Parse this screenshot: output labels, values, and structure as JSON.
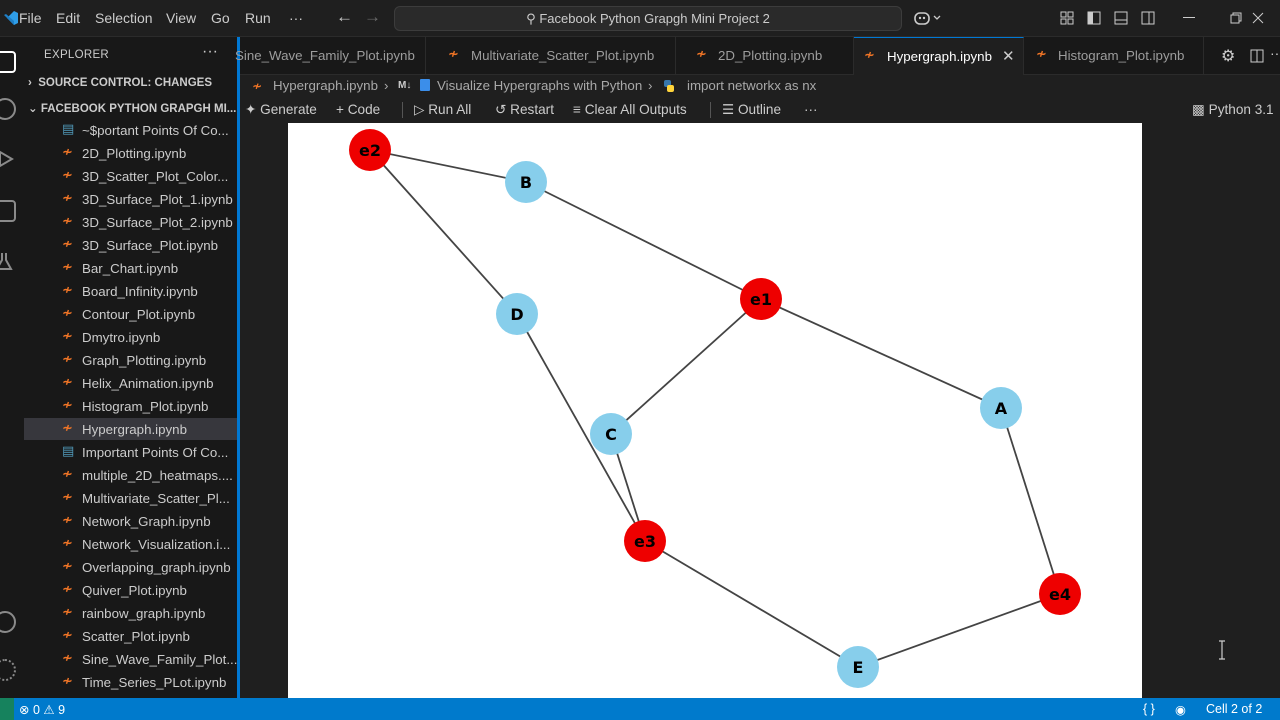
{
  "menu": [
    "File",
    "Edit",
    "Selection",
    "View",
    "Go",
    "Run",
    "···"
  ],
  "search": {
    "label": "Facebook Python Grapgh Mini Project 2"
  },
  "explorer": {
    "title": "EXPLORER",
    "more": "···",
    "source_control": "SOURCE CONTROL: CHANGES",
    "project": "FACEBOOK PYTHON GRAPGH MI...",
    "files": [
      {
        "name": "~$portant Points Of Co...",
        "kind": "md"
      },
      {
        "name": "2D_Plotting.ipynb",
        "kind": "nb"
      },
      {
        "name": "3D_Scatter_Plot_Color...",
        "kind": "nb"
      },
      {
        "name": "3D_Surface_Plot_1.ipynb",
        "kind": "nb"
      },
      {
        "name": "3D_Surface_Plot_2.ipynb",
        "kind": "nb"
      },
      {
        "name": "3D_Surface_Plot.ipynb",
        "kind": "nb"
      },
      {
        "name": "Bar_Chart.ipynb",
        "kind": "nb"
      },
      {
        "name": "Board_Infinity.ipynb",
        "kind": "nb"
      },
      {
        "name": "Contour_Plot.ipynb",
        "kind": "nb"
      },
      {
        "name": "Dmytro.ipynb",
        "kind": "nb"
      },
      {
        "name": "Graph_Plotting.ipynb",
        "kind": "nb"
      },
      {
        "name": "Helix_Animation.ipynb",
        "kind": "nb"
      },
      {
        "name": "Histogram_Plot.ipynb",
        "kind": "nb"
      },
      {
        "name": "Hypergraph.ipynb",
        "kind": "nb",
        "selected": true
      },
      {
        "name": "Important Points Of Co...",
        "kind": "md"
      },
      {
        "name": "multiple_2D_heatmaps....",
        "kind": "nb"
      },
      {
        "name": "Multivariate_Scatter_Pl...",
        "kind": "nb"
      },
      {
        "name": "Network_Graph.ipynb",
        "kind": "nb"
      },
      {
        "name": "Network_Visualization.i...",
        "kind": "nb"
      },
      {
        "name": "Overlapping_graph.ipynb",
        "kind": "nb"
      },
      {
        "name": "Quiver_Plot.ipynb",
        "kind": "nb"
      },
      {
        "name": "rainbow_graph.ipynb",
        "kind": "nb"
      },
      {
        "name": "Scatter_Plot.ipynb",
        "kind": "nb"
      },
      {
        "name": "Sine_Wave_Family_Plot....",
        "kind": "nb"
      },
      {
        "name": "Time_Series_PLot.ipynb",
        "kind": "nb"
      }
    ]
  },
  "tabs": [
    {
      "label": "Sine_Wave_Family_Plot.ipynb"
    },
    {
      "label": "Multivariate_Scatter_Plot.ipynb"
    },
    {
      "label": "2D_Plotting.ipynb"
    },
    {
      "label": "Hypergraph.ipynb",
      "active": true
    },
    {
      "label": "Histogram_Plot.ipynb"
    }
  ],
  "breadcrumb": {
    "file": "Hypergraph.ipynb",
    "md_badge": "M↓",
    "heading": "Visualize Hypergraphs with Python",
    "cell": "import networkx as nx"
  },
  "toolbar": {
    "generate": "Generate",
    "code": "Code",
    "run_all": "Run All",
    "restart": "Restart",
    "clear": "Clear All Outputs",
    "outline": "Outline",
    "more": "···",
    "kernel": "Python 3.1"
  },
  "graph": {
    "node_color": "#87ceeb",
    "edge_node_color": "#ee0000",
    "nodes": [
      {
        "id": "e2",
        "type": "hyperedge"
      },
      {
        "id": "B",
        "type": "vertex"
      },
      {
        "id": "D",
        "type": "vertex"
      },
      {
        "id": "e1",
        "type": "hyperedge"
      },
      {
        "id": "A",
        "type": "vertex"
      },
      {
        "id": "C",
        "type": "vertex"
      },
      {
        "id": "e3",
        "type": "hyperedge"
      },
      {
        "id": "e4",
        "type": "hyperedge"
      },
      {
        "id": "E",
        "type": "vertex"
      }
    ],
    "edges": [
      [
        "e2",
        "B"
      ],
      [
        "e2",
        "D"
      ],
      [
        "B",
        "e1"
      ],
      [
        "e1",
        "A"
      ],
      [
        "e1",
        "C"
      ],
      [
        "D",
        "e3"
      ],
      [
        "C",
        "e3"
      ],
      [
        "e3",
        "E"
      ],
      [
        "E",
        "e4"
      ],
      [
        "A",
        "e4"
      ]
    ]
  },
  "status": {
    "errors": "0",
    "warnings": "9",
    "braces": "{ }",
    "cell": "Cell 2 of 2"
  }
}
